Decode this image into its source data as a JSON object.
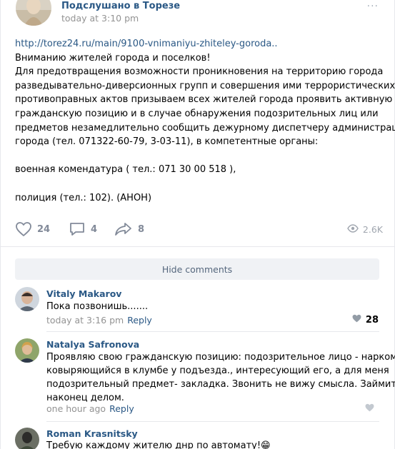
{
  "post": {
    "group_name": "Подслушано в Торезе",
    "time": "today at 3:10 pm",
    "link": "http://torez24.ru/main/9100-vnimaniyu-zhiteley-goroda..",
    "lines": [
      "Вниманию жителей города и поселков!",
      "Для предотвращения возможности проникновения на территорию города",
      "разведывательно-диверсионных групп и совершения ими террористических,",
      "противоправных актов призываем всех жителей города проявить активную",
      "гражданскую позицию и в случае обнаружения подозрительных лиц или",
      "предметов незамедлительно сообщить дежурному диспетчеру администрации",
      "города (тел. 071322-60-79, 3-03-11), в компетентные органы:"
    ],
    "line_military": "военная комендатура ( тел.: 071 30 00 518 ),",
    "line_police": "полиция (тел.: 102). (АНОН)",
    "more": "···",
    "likes": "24",
    "comments": "4",
    "shares": "8",
    "views": "2.6K"
  },
  "hide_comments_label": "Hide comments",
  "comments": [
    {
      "author": "Vitaly Makarov",
      "lines": [
        "Пока позвонишь......."
      ],
      "time": "today at 3:16 pm",
      "reply": "Reply",
      "likes": "28"
    },
    {
      "author": "Natalya Safronova",
      "lines": [
        "Проявляю свою гражданскую позицию: подозрительное лицо - наркоман,",
        "ковыряющийся в клумбе у подъезда., интересующий его, а для меня",
        "подозрительный предмет- закладка. Звонить не вижу смысла. Займитесь",
        "наконец делом."
      ],
      "time": "one hour ago",
      "reply": "Reply",
      "likes": ""
    },
    {
      "author": "Roman Krasnitsky",
      "lines": [
        "Требую каждому жителю днр по автомату!😁"
      ],
      "time": "",
      "reply": "",
      "likes": ""
    }
  ],
  "icons": {
    "like": "heart-icon",
    "comment": "comment-bubble-icon",
    "share": "share-arrow-icon",
    "views": "eye-icon"
  },
  "colors": {
    "link": "#2a5885",
    "meta": "#939393",
    "action": "#828a99",
    "button_bg": "#f0f2f5"
  }
}
